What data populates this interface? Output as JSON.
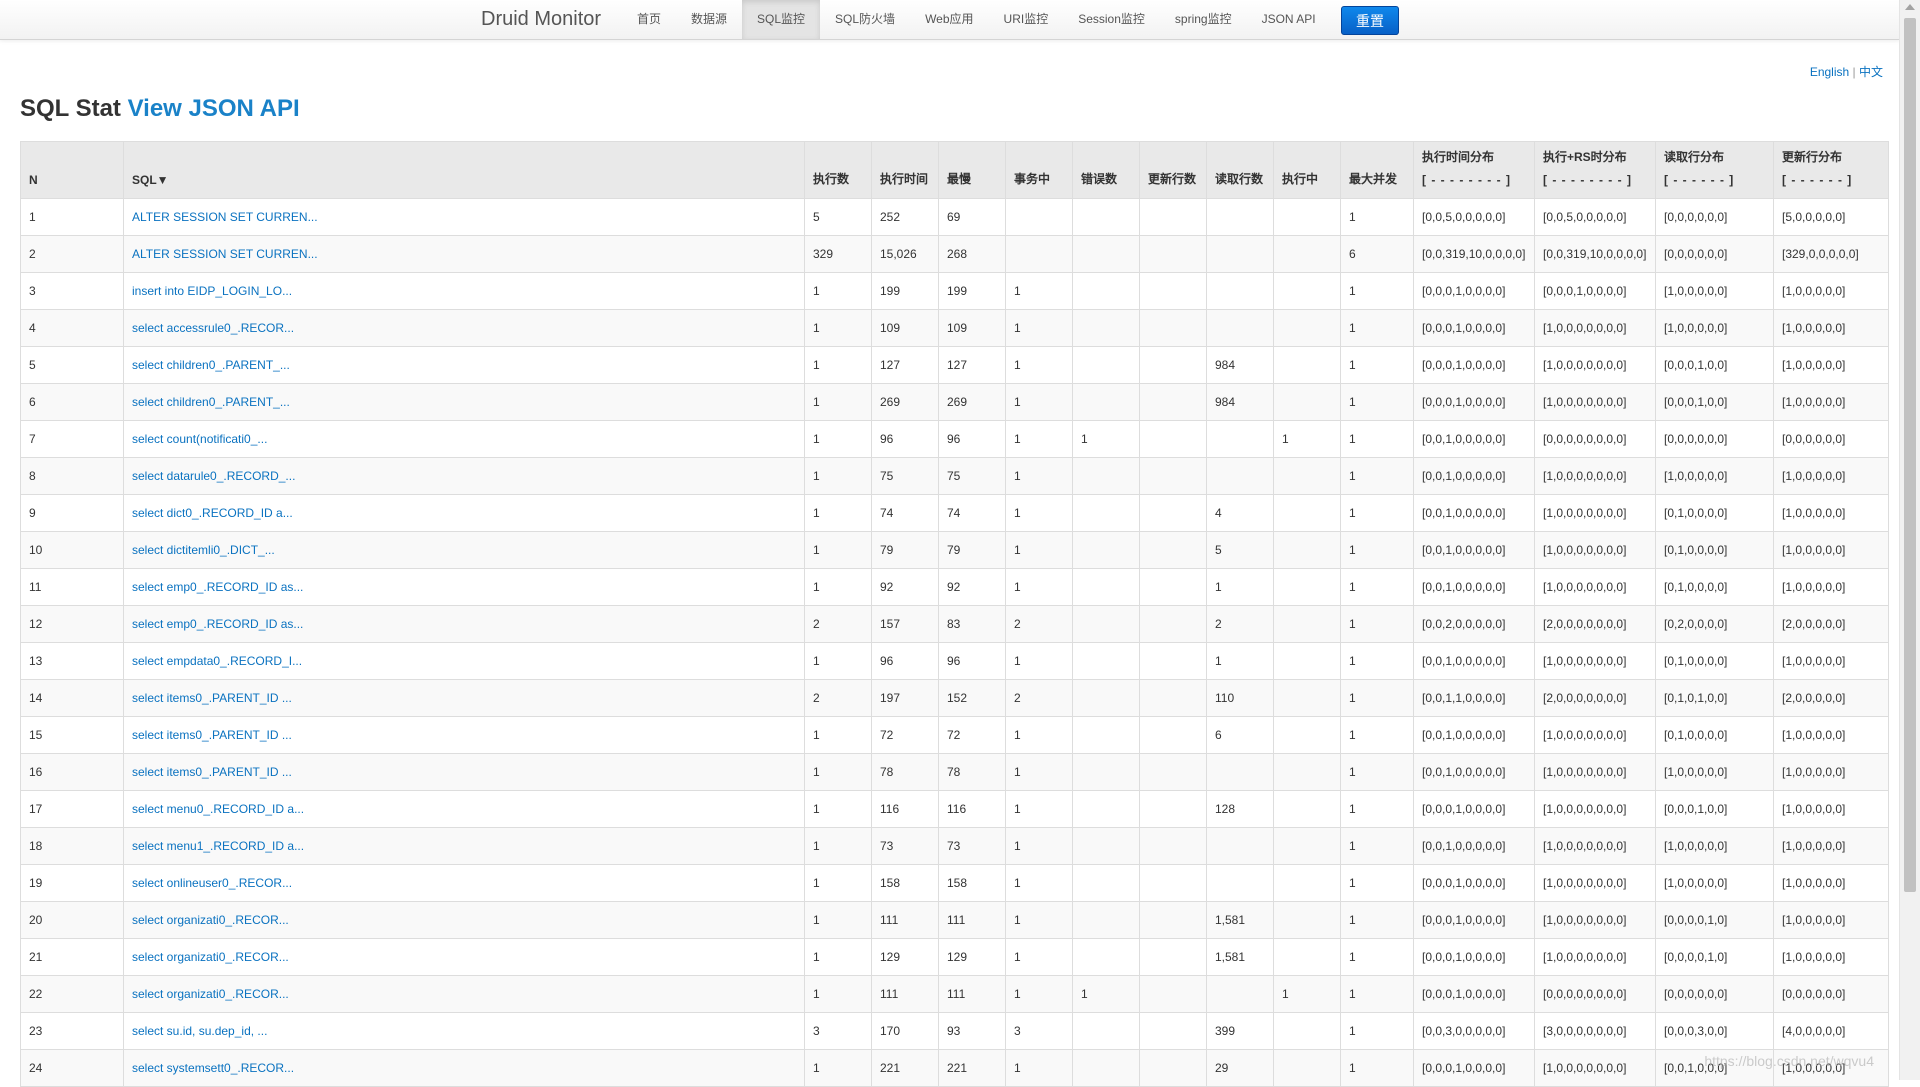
{
  "navbar": {
    "brand": "Druid Monitor",
    "items": [
      "首页",
      "数据源",
      "SQL监控",
      "SQL防火墙",
      "Web应用",
      "URI监控",
      "Session监控",
      "spring监控",
      "JSON API"
    ],
    "active_index": 2,
    "reset_label": "重置",
    "accent_color": "#0760c7"
  },
  "lang": {
    "english": "English",
    "sep": "|",
    "chinese": "中文"
  },
  "title": {
    "prefix": "SQL Stat",
    "link": "View JSON API"
  },
  "table": {
    "headers": {
      "n": "N",
      "sql": "SQL▼",
      "exec_count": "执行数",
      "exec_time": "执行时间",
      "slowest": "最慢",
      "in_txn": "事务中",
      "errors": "错误数",
      "update_rows": "更新行数",
      "fetch_rows": "读取行数",
      "executing": "执行中",
      "max_concurrent": "最大并发",
      "exec_hist": "执行时间分布",
      "exec_hist_sub": "[ - - - - - - - - ]",
      "exec_rs_hist": "执行+RS时分布",
      "exec_rs_hist_sub": "[ - - - - - - - - ]",
      "fetch_hist": "读取行分布",
      "fetch_hist_sub": "[ - - - - - - ]",
      "update_hist": "更新行分布",
      "update_hist_sub": "[ - - - - - - ]"
    },
    "rows": [
      [
        "1",
        "ALTER SESSION SET CURREN...",
        "5",
        "252",
        "69",
        "",
        "",
        "",
        "",
        "",
        "1",
        "[0,0,5,0,0,0,0,0]",
        "[0,0,5,0,0,0,0,0]",
        "[0,0,0,0,0,0]",
        "[5,0,0,0,0,0]"
      ],
      [
        "2",
        "ALTER SESSION SET CURREN...",
        "329",
        "15,026",
        "268",
        "",
        "",
        "",
        "",
        "",
        "6",
        "[0,0,319,10,0,0,0,0]",
        "[0,0,319,10,0,0,0,0]",
        "[0,0,0,0,0,0]",
        "[329,0,0,0,0,0]"
      ],
      [
        "3",
        "insert into EIDP_LOGIN_LO...",
        "1",
        "199",
        "199",
        "1",
        "",
        "",
        "",
        "",
        "1",
        "[0,0,0,1,0,0,0,0]",
        "[0,0,0,1,0,0,0,0]",
        "[1,0,0,0,0,0]",
        "[1,0,0,0,0,0]"
      ],
      [
        "4",
        "select accessrule0_.RECOR...",
        "1",
        "109",
        "109",
        "1",
        "",
        "",
        "",
        "",
        "1",
        "[0,0,0,1,0,0,0,0]",
        "[1,0,0,0,0,0,0,0]",
        "[1,0,0,0,0,0]",
        "[1,0,0,0,0,0]"
      ],
      [
        "5",
        "select children0_.PARENT_...",
        "1",
        "127",
        "127",
        "1",
        "",
        "",
        "984",
        "",
        "1",
        "[0,0,0,1,0,0,0,0]",
        "[1,0,0,0,0,0,0,0]",
        "[0,0,0,1,0,0]",
        "[1,0,0,0,0,0]"
      ],
      [
        "6",
        "select children0_.PARENT_...",
        "1",
        "269",
        "269",
        "1",
        "",
        "",
        "984",
        "",
        "1",
        "[0,0,0,1,0,0,0,0]",
        "[1,0,0,0,0,0,0,0]",
        "[0,0,0,1,0,0]",
        "[1,0,0,0,0,0]"
      ],
      [
        "7",
        "select count(notificati0_...",
        "1",
        "96",
        "96",
        "1",
        "1",
        "",
        "",
        "1",
        "1",
        "[0,0,1,0,0,0,0,0]",
        "[0,0,0,0,0,0,0,0]",
        "[0,0,0,0,0,0]",
        "[0,0,0,0,0,0]"
      ],
      [
        "8",
        "select datarule0_.RECORD_...",
        "1",
        "75",
        "75",
        "1",
        "",
        "",
        "",
        "",
        "1",
        "[0,0,1,0,0,0,0,0]",
        "[1,0,0,0,0,0,0,0]",
        "[1,0,0,0,0,0]",
        "[1,0,0,0,0,0]"
      ],
      [
        "9",
        "select dict0_.RECORD_ID a...",
        "1",
        "74",
        "74",
        "1",
        "",
        "",
        "4",
        "",
        "1",
        "[0,0,1,0,0,0,0,0]",
        "[1,0,0,0,0,0,0,0]",
        "[0,1,0,0,0,0]",
        "[1,0,0,0,0,0]"
      ],
      [
        "10",
        "select dictitemli0_.DICT_...",
        "1",
        "79",
        "79",
        "1",
        "",
        "",
        "5",
        "",
        "1",
        "[0,0,1,0,0,0,0,0]",
        "[1,0,0,0,0,0,0,0]",
        "[0,1,0,0,0,0]",
        "[1,0,0,0,0,0]"
      ],
      [
        "11",
        "select emp0_.RECORD_ID as...",
        "1",
        "92",
        "92",
        "1",
        "",
        "",
        "1",
        "",
        "1",
        "[0,0,1,0,0,0,0,0]",
        "[1,0,0,0,0,0,0,0]",
        "[0,1,0,0,0,0]",
        "[1,0,0,0,0,0]"
      ],
      [
        "12",
        "select emp0_.RECORD_ID as...",
        "2",
        "157",
        "83",
        "2",
        "",
        "",
        "2",
        "",
        "1",
        "[0,0,2,0,0,0,0,0]",
        "[2,0,0,0,0,0,0,0]",
        "[0,2,0,0,0,0]",
        "[2,0,0,0,0,0]"
      ],
      [
        "13",
        "select empdata0_.RECORD_I...",
        "1",
        "96",
        "96",
        "1",
        "",
        "",
        "1",
        "",
        "1",
        "[0,0,1,0,0,0,0,0]",
        "[1,0,0,0,0,0,0,0]",
        "[0,1,0,0,0,0]",
        "[1,0,0,0,0,0]"
      ],
      [
        "14",
        "select items0_.PARENT_ID ...",
        "2",
        "197",
        "152",
        "2",
        "",
        "",
        "110",
        "",
        "1",
        "[0,0,1,1,0,0,0,0]",
        "[2,0,0,0,0,0,0,0]",
        "[0,1,0,1,0,0]",
        "[2,0,0,0,0,0]"
      ],
      [
        "15",
        "select items0_.PARENT_ID ...",
        "1",
        "72",
        "72",
        "1",
        "",
        "",
        "6",
        "",
        "1",
        "[0,0,1,0,0,0,0,0]",
        "[1,0,0,0,0,0,0,0]",
        "[0,1,0,0,0,0]",
        "[1,0,0,0,0,0]"
      ],
      [
        "16",
        "select items0_.PARENT_ID ...",
        "1",
        "78",
        "78",
        "1",
        "",
        "",
        "",
        "",
        "1",
        "[0,0,1,0,0,0,0,0]",
        "[1,0,0,0,0,0,0,0]",
        "[1,0,0,0,0,0]",
        "[1,0,0,0,0,0]"
      ],
      [
        "17",
        "select menu0_.RECORD_ID a...",
        "1",
        "116",
        "116",
        "1",
        "",
        "",
        "128",
        "",
        "1",
        "[0,0,0,1,0,0,0,0]",
        "[1,0,0,0,0,0,0,0]",
        "[0,0,0,1,0,0]",
        "[1,0,0,0,0,0]"
      ],
      [
        "18",
        "select menu1_.RECORD_ID a...",
        "1",
        "73",
        "73",
        "1",
        "",
        "",
        "",
        "",
        "1",
        "[0,0,1,0,0,0,0,0]",
        "[1,0,0,0,0,0,0,0]",
        "[1,0,0,0,0,0]",
        "[1,0,0,0,0,0]"
      ],
      [
        "19",
        "select onlineuser0_.RECOR...",
        "1",
        "158",
        "158",
        "1",
        "",
        "",
        "",
        "",
        "1",
        "[0,0,0,1,0,0,0,0]",
        "[1,0,0,0,0,0,0,0]",
        "[1,0,0,0,0,0]",
        "[1,0,0,0,0,0]"
      ],
      [
        "20",
        "select organizati0_.RECOR...",
        "1",
        "111",
        "111",
        "1",
        "",
        "",
        "1,581",
        "",
        "1",
        "[0,0,0,1,0,0,0,0]",
        "[1,0,0,0,0,0,0,0]",
        "[0,0,0,0,1,0]",
        "[1,0,0,0,0,0]"
      ],
      [
        "21",
        "select organizati0_.RECOR...",
        "1",
        "129",
        "129",
        "1",
        "",
        "",
        "1,581",
        "",
        "1",
        "[0,0,0,1,0,0,0,0]",
        "[1,0,0,0,0,0,0,0]",
        "[0,0,0,0,1,0]",
        "[1,0,0,0,0,0]"
      ],
      [
        "22",
        "select organizati0_.RECOR...",
        "1",
        "111",
        "111",
        "1",
        "1",
        "",
        "",
        "1",
        "1",
        "[0,0,0,1,0,0,0,0]",
        "[0,0,0,0,0,0,0,0]",
        "[0,0,0,0,0,0]",
        "[0,0,0,0,0,0]"
      ],
      [
        "23",
        "select su.id, su.dep_id, ...",
        "3",
        "170",
        "93",
        "3",
        "",
        "",
        "399",
        "",
        "1",
        "[0,0,3,0,0,0,0,0]",
        "[3,0,0,0,0,0,0,0]",
        "[0,0,0,3,0,0]",
        "[4,0,0,0,0,0]"
      ],
      [
        "24",
        "select systemsett0_.RECOR...",
        "1",
        "221",
        "221",
        "1",
        "",
        "",
        "29",
        "",
        "1",
        "[0,0,0,1,0,0,0,0]",
        "[1,0,0,0,0,0,0,0]",
        "[0,0,1,0,0,0]",
        "[1,0,0,0,0,0]"
      ]
    ]
  },
  "watermark": "https://blog.csdn.net/wqvu4"
}
